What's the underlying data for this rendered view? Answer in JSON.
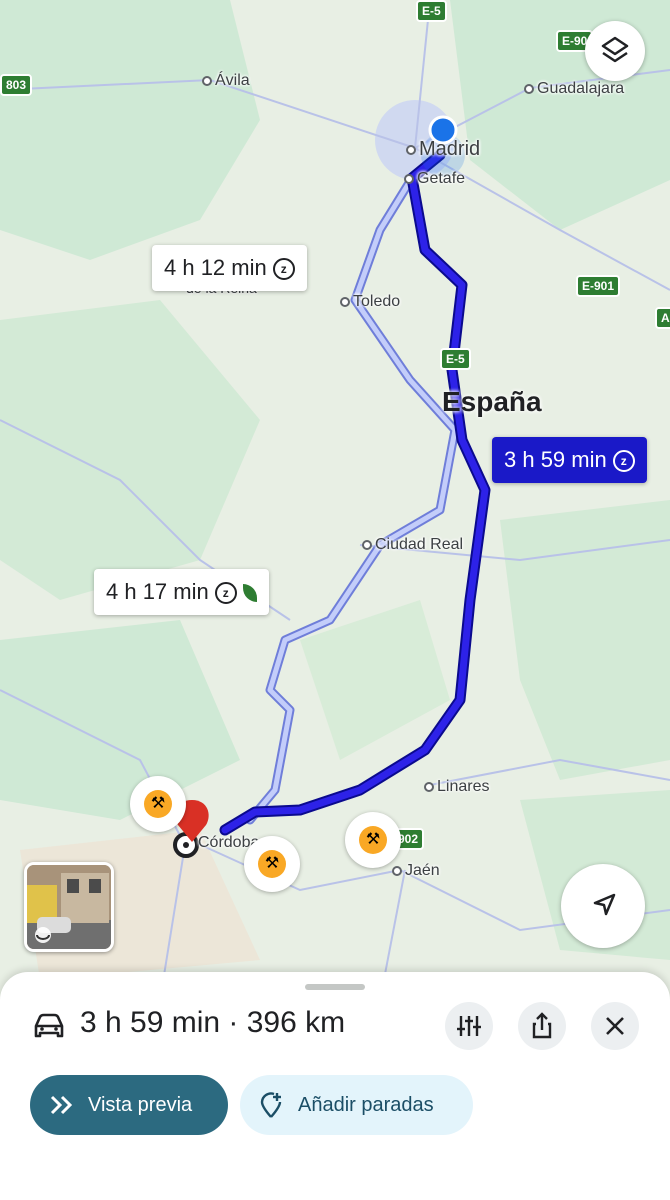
{
  "map": {
    "cities": [
      {
        "name": "Ávila"
      },
      {
        "name": "Guadalajara"
      },
      {
        "name": "Madrid"
      },
      {
        "name": "Getafe"
      },
      {
        "name": "Toledo"
      },
      {
        "name": "de la Reina"
      },
      {
        "name": "Ciudad Real"
      },
      {
        "name": "Linares"
      },
      {
        "name": "Jaén"
      },
      {
        "name": "Córdoba"
      }
    ],
    "country_label": "España",
    "road_shields": [
      "E-5",
      "E-90",
      "803",
      "E-901",
      "E-5",
      "A",
      "E-902"
    ],
    "route_callouts": {
      "main": "3 h 59 min",
      "alt1": "4 h 12 min",
      "alt2": "4 h 17 min"
    },
    "colors": {
      "route_main": "#1a19c8",
      "route_alt": "#8fa6f0",
      "origin": "#1a73e8",
      "destination": "#d93025"
    }
  },
  "bottom_sheet": {
    "summary": "3 h 59 min · 396 km",
    "preview_label": "Vista previa",
    "add_stops_label": "Añadir paradas"
  },
  "icons": [
    "car-icon",
    "filter-icon",
    "share-icon",
    "close-icon",
    "layers-icon",
    "navigate-icon",
    "street-view-icon"
  ]
}
